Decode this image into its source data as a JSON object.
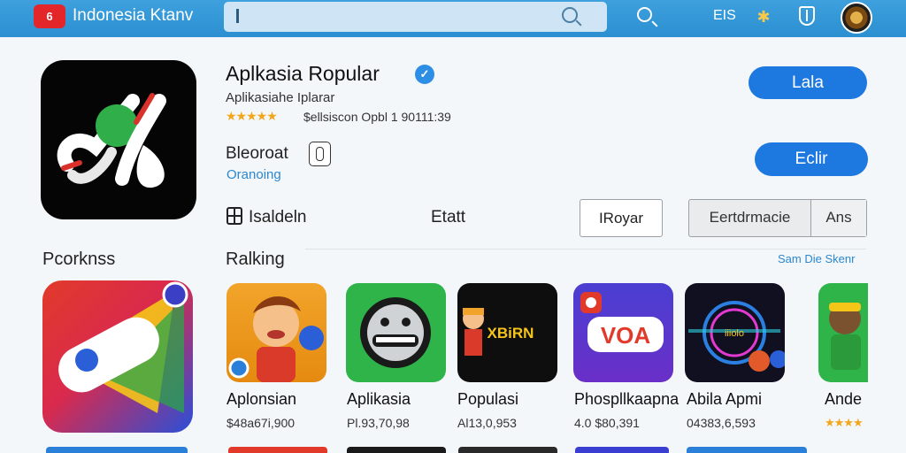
{
  "header": {
    "logo_text": "6",
    "brand": "Indonesia Ktanv",
    "search_placeholder": "",
    "lang_label": "EIS"
  },
  "app": {
    "title": "Aplkasia Ropular",
    "subtitle": "Aplikasiahe Iplarar",
    "rating_stars": "★★★★★",
    "rating_meta": "$ellsiscon Opbl 1 90111:39",
    "developer": "Bleoroat",
    "developer_tag": "Oranoing",
    "meta_label_1": "Isaldeln",
    "meta_label_2": "Etatt",
    "install_label": "Lala",
    "edit_label": "Eclir",
    "outline_button": "IRoyar",
    "segment_left": "Eertdrmacie",
    "segment_right": "Ans"
  },
  "sections": {
    "left_heading": "Pcorknss",
    "right_heading": "Ralking",
    "see_all": "Sam Die Skenr"
  },
  "ranking": [
    {
      "name": "Aplonsian",
      "price": "$48a67i,900"
    },
    {
      "name": "Aplikasia",
      "price": "Pl.93,70,98"
    },
    {
      "name": "Populasi",
      "price": "Al13,0,953"
    },
    {
      "name": "Phospllkaapna",
      "price": "4.0 $80,391"
    },
    {
      "name": "Abila Apmi",
      "price": "04383,6,593"
    },
    {
      "name": "Ande",
      "stars": "★★★★"
    }
  ],
  "card_texts": {
    "poster_text": "XBiRN",
    "voa_text": "VOA",
    "neon_text": "iiiolo"
  },
  "colors": {
    "header_blue": "#2b8fd1",
    "primary_button": "#1d78e0",
    "link_blue": "#2a87cf",
    "star_gold": "#f2a619"
  }
}
